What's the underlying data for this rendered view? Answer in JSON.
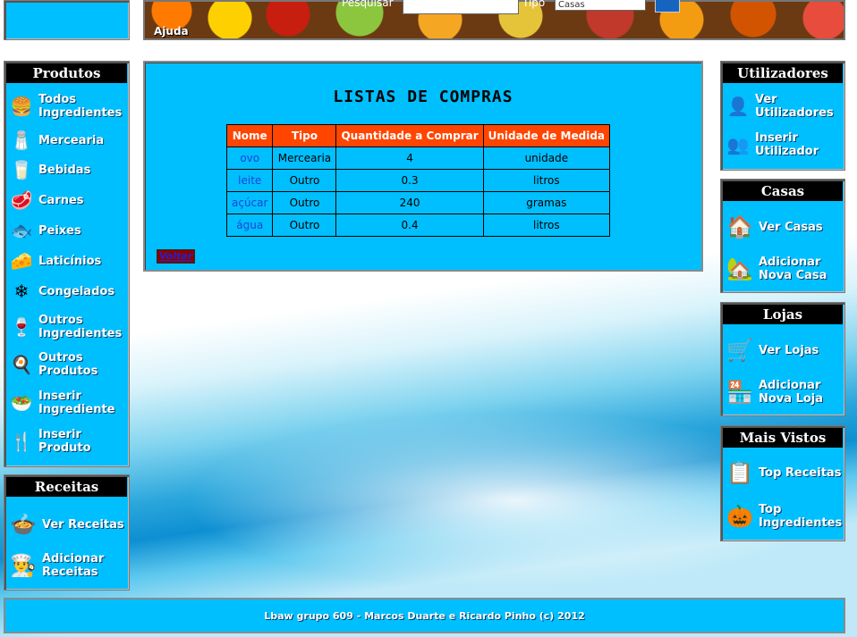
{
  "header": {
    "ajuda": "Ajuda",
    "search_label": "Pesquisar",
    "type_label": "Tipo",
    "type_value": "Casas"
  },
  "left": {
    "produtos": {
      "title": "Produtos",
      "items": [
        {
          "label": "Todos Ingredientes",
          "icon": "burger-icon"
        },
        {
          "label": "Mercearia",
          "icon": "grocery-icon"
        },
        {
          "label": "Bebidas",
          "icon": "glass-icon"
        },
        {
          "label": "Carnes",
          "icon": "meat-icon"
        },
        {
          "label": "Peixes",
          "icon": "fish-icon"
        },
        {
          "label": "Laticínios",
          "icon": "dairy-icon"
        },
        {
          "label": "Congelados",
          "icon": "snowflake-icon"
        },
        {
          "label": "Outros Ingredientes",
          "icon": "ingredients-icon"
        },
        {
          "label": "Outros Produtos",
          "icon": "pan-icon"
        },
        {
          "label": "Inserir Ingrediente",
          "icon": "insert-ingredient-icon"
        },
        {
          "label": "Inserir Produto",
          "icon": "fork-knife-icon"
        }
      ]
    },
    "receitas": {
      "title": "Receitas",
      "items": [
        {
          "label": "Ver Receitas",
          "icon": "pot-icon"
        },
        {
          "label": "Adicionar Receitas",
          "icon": "chef-hat-icon"
        }
      ]
    }
  },
  "right": {
    "utilizadores": {
      "title": "Utilizadores",
      "items": [
        {
          "label": "Ver Utilizadores",
          "icon": "user-icon"
        },
        {
          "label": "Inserir Utilizador",
          "icon": "add-user-icon"
        }
      ]
    },
    "casas": {
      "title": "Casas",
      "items": [
        {
          "label": "Ver Casas",
          "icon": "house-icon"
        },
        {
          "label": "Adicionar Nova Casa",
          "icon": "add-house-icon"
        }
      ]
    },
    "lojas": {
      "title": "Lojas",
      "items": [
        {
          "label": "Ver Lojas",
          "icon": "cart-icon"
        },
        {
          "label": "Adicionar Nova Loja",
          "icon": "add-store-icon"
        }
      ]
    },
    "mais_vistos": {
      "title": "Mais Vistos",
      "items": [
        {
          "label": "Top Receitas",
          "icon": "clipboard-icon"
        },
        {
          "label": "Top Ingredientes",
          "icon": "pumpkin-icon"
        }
      ]
    }
  },
  "main": {
    "title": "LISTAS DE COMPRAS",
    "columns": [
      "Nome",
      "Tipo",
      "Quantidade a Comprar",
      "Unidade de Medida"
    ],
    "rows": [
      [
        "ovo",
        "Mercearia",
        "4",
        "unidade"
      ],
      [
        "leite",
        "Outro",
        "0.3",
        "litros"
      ],
      [
        "açúcar",
        "Outro",
        "240",
        "gramas"
      ],
      [
        "água",
        "Outro",
        "0.4",
        "litros"
      ]
    ],
    "back_label": "Voltar"
  },
  "footer": {
    "text": "Lbaw grupo 609 - Marcos Duarte e Ricardo Pinho (c) 2012"
  },
  "colors": {
    "panel": "#00bfff",
    "table_header": "#ff4500",
    "link": "#1a44d6"
  }
}
